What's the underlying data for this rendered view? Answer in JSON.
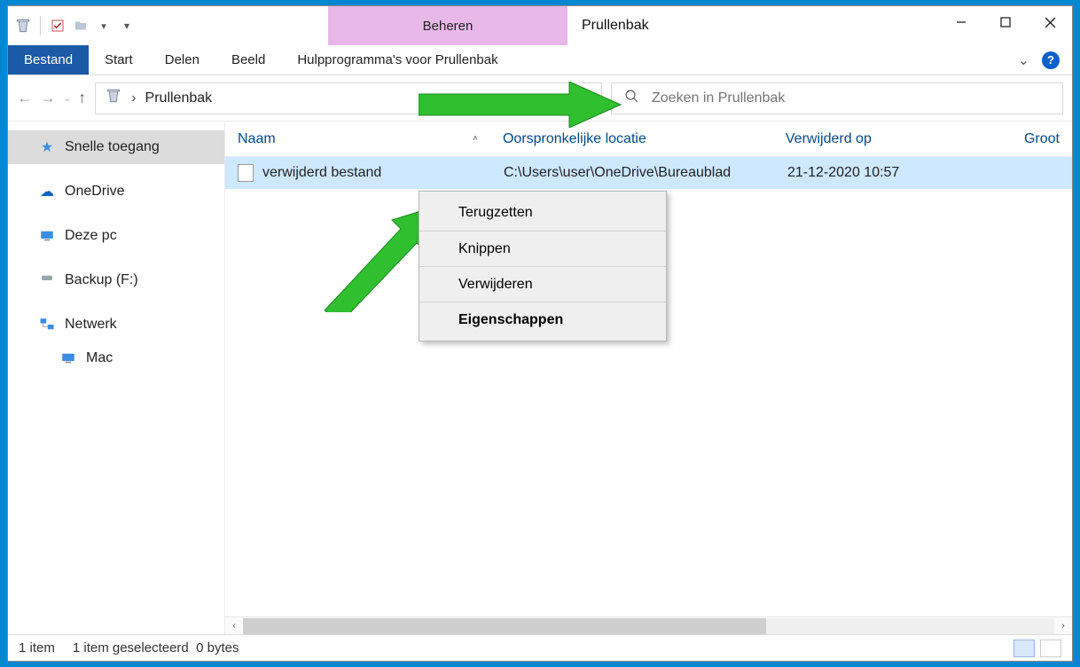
{
  "window": {
    "title": "Prullenbak",
    "contextual_tab": "Beheren"
  },
  "ribbon": {
    "file": "Bestand",
    "tabs": [
      "Start",
      "Delen",
      "Beeld"
    ],
    "contextual": "Hulpprogramma's voor Prullenbak"
  },
  "breadcrumb": {
    "location": "Prullenbak"
  },
  "search": {
    "placeholder": "Zoeken in Prullenbak"
  },
  "sidebar": {
    "items": [
      {
        "label": "Snelle toegang",
        "icon": "star"
      },
      {
        "label": "OneDrive",
        "icon": "cloud"
      },
      {
        "label": "Deze pc",
        "icon": "pc"
      },
      {
        "label": "Backup (F:)",
        "icon": "drive"
      },
      {
        "label": "Netwerk",
        "icon": "network"
      },
      {
        "label": "Mac",
        "icon": "pc-remote"
      }
    ]
  },
  "columns": {
    "name": "Naam",
    "original": "Oorspronkelijke locatie",
    "deleted": "Verwijderd op",
    "size": "Groot"
  },
  "rows": [
    {
      "name": "verwijderd bestand",
      "original": "C:\\Users\\user\\OneDrive\\Bureaublad",
      "deleted": "21-12-2020 10:57"
    }
  ],
  "context_menu": {
    "items": [
      "Terugzetten",
      "Knippen",
      "Verwijderen",
      "Eigenschappen"
    ]
  },
  "statusbar": {
    "count": "1 item",
    "selected": "1 item geselecteerd",
    "size": "0 bytes"
  }
}
